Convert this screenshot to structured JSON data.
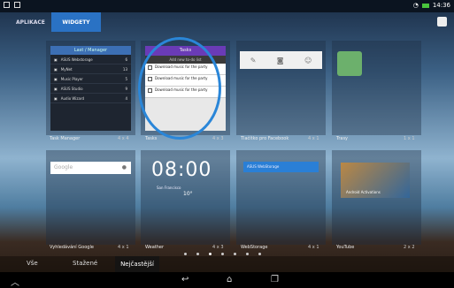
{
  "status": {
    "time": "14:36"
  },
  "tabs": {
    "apps": "APLIKACE",
    "widgets": "WIDGETY"
  },
  "widgets": [
    {
      "name": "Task Manager",
      "size": "4 x 4"
    },
    {
      "name": "Tasks",
      "size": "4 x 3"
    },
    {
      "name": "Tlačítko pro Facebook",
      "size": "4 x 1"
    },
    {
      "name": "Trasy",
      "size": "1 x 1"
    },
    {
      "name": "Vyhledávání Google",
      "size": "4 x 1"
    },
    {
      "name": "Weather",
      "size": "4 x 3"
    },
    {
      "name": "WebStorage",
      "size": "4 x 1"
    },
    {
      "name": "YouTube",
      "size": "2 x 2"
    }
  ],
  "task_manager": {
    "header": "Last / Manager",
    "rows": [
      {
        "name": "ASUS Webstorage",
        "val": "6"
      },
      {
        "name": "MyNet",
        "val": "13"
      },
      {
        "name": "Music Player",
        "val": "5"
      },
      {
        "name": "ASUS Studio",
        "val": "9"
      },
      {
        "name": "Audio Wizard",
        "val": "4"
      }
    ]
  },
  "tasks": {
    "header": "Tasks",
    "add": "Add new to-do list",
    "items": [
      "Download music for the party",
      "Download music for the party",
      "Download music for the party"
    ]
  },
  "google": {
    "placeholder": "Google"
  },
  "weather": {
    "time": "08:00",
    "date": "San Francisco",
    "temp": "10°"
  },
  "webstorage": {
    "label": "ASUS WebStorage"
  },
  "youtube": {
    "caption": "Android Activations"
  },
  "categories": {
    "all": "Vše",
    "downloaded": "Stažené",
    "top": "Nejčastější"
  }
}
